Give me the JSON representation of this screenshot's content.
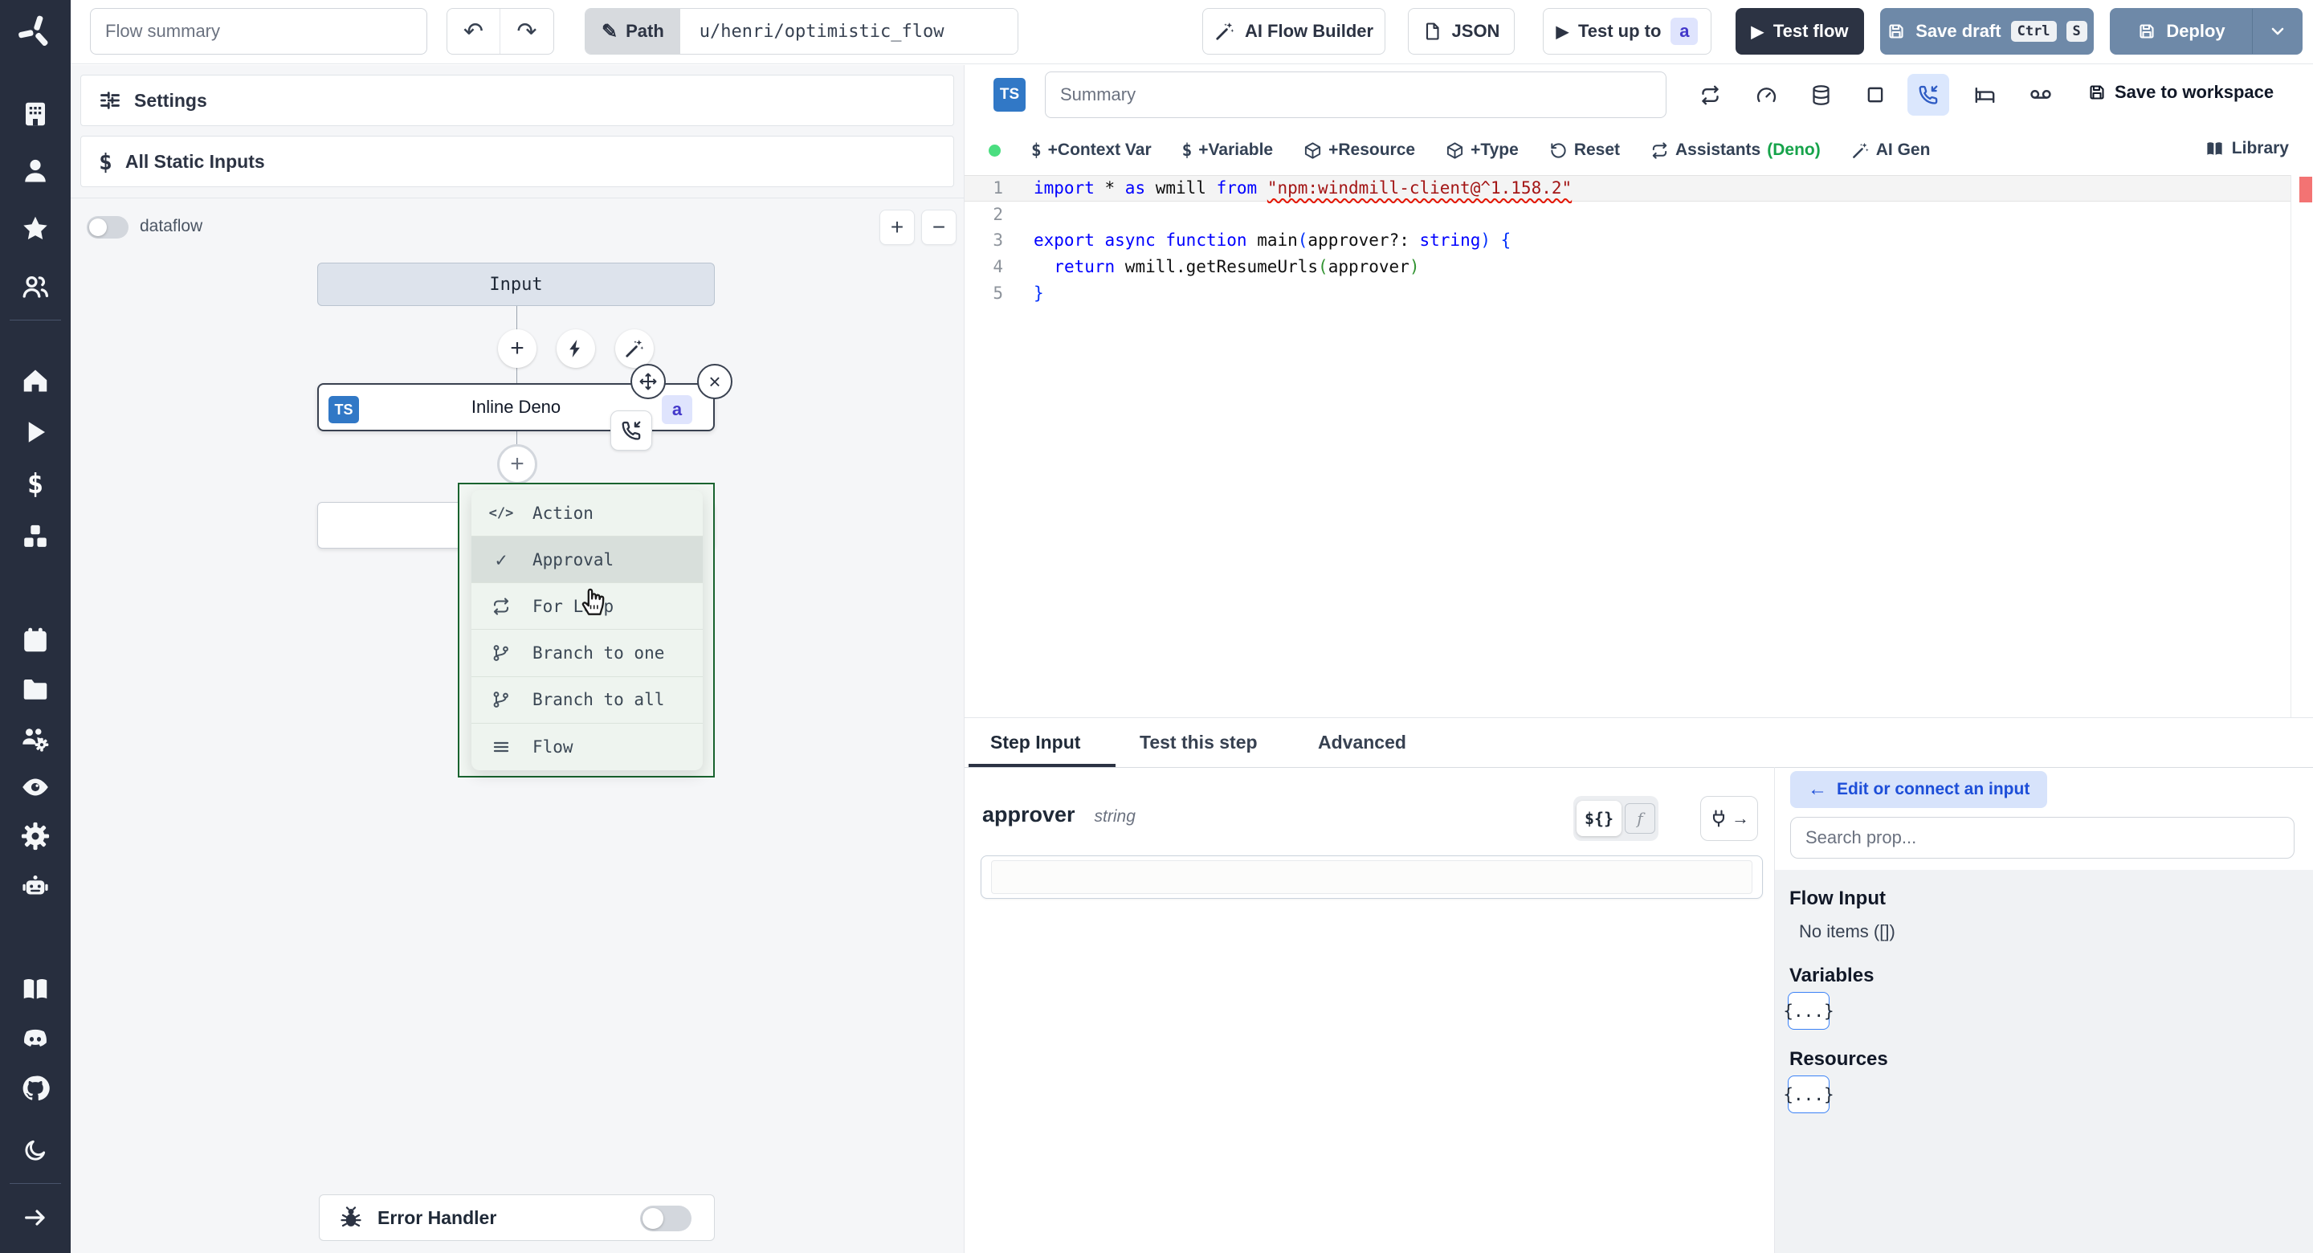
{
  "topbar": {
    "summary_placeholder": "Flow summary",
    "path_label": "Path",
    "path_value": "u/henri/optimistic_flow",
    "ai_flow_builder": "AI Flow Builder",
    "json_button": "JSON",
    "test_up_to": "Test up to",
    "step_badge": "a",
    "test_flow": "Test flow",
    "save_draft": "Save draft",
    "kbd_ctrl": "Ctrl",
    "kbd_s": "S",
    "deploy": "Deploy"
  },
  "sidebar": {
    "icons": [
      "windmill-logo",
      "workspace-building",
      "user",
      "favorites-star",
      "groups",
      "home",
      "runs-play",
      "variables-dollar",
      "resources-cubes",
      "schedules-calendar",
      "folders",
      "workers",
      "audit-eye",
      "settings-gear",
      "ai-robot",
      "docs-book",
      "discord",
      "github",
      "dark-mode-moon",
      "expand-arrow"
    ]
  },
  "flow_panel": {
    "settings": "Settings",
    "all_static_inputs": "All Static Inputs",
    "dataflow": "dataflow",
    "zoom_in": "+",
    "zoom_out": "−",
    "input_node": "Input",
    "step": {
      "lang_badge": "TS",
      "title": "Inline Deno",
      "id_badge": "a"
    },
    "insert_menu": {
      "items": [
        {
          "icon": "code",
          "label": "Action",
          "highlighted": false
        },
        {
          "icon": "check",
          "label": "Approval",
          "highlighted": true
        },
        {
          "icon": "repeat",
          "label": "For Loop",
          "highlighted": false
        },
        {
          "icon": "branch",
          "label": "Branch to one",
          "highlighted": false
        },
        {
          "icon": "branch",
          "label": "Branch to all",
          "highlighted": false
        },
        {
          "icon": "flow",
          "label": "Flow",
          "highlighted": false
        }
      ]
    },
    "error_handler": "Error Handler"
  },
  "editor": {
    "lang_badge": "TS",
    "summary_placeholder": "Summary",
    "save_to_workspace": "Save to workspace",
    "actions": {
      "context_var": "+Context Var",
      "variable": "+Variable",
      "resource": "+Resource",
      "type": "+Type",
      "reset": "Reset",
      "assistants": "Assistants",
      "assistants_lang": "(Deno)",
      "ai_gen": "AI Gen",
      "library": "Library"
    },
    "code": {
      "lines": [
        {
          "num": "1",
          "highlight": true,
          "tokens": [
            {
              "c": "kw",
              "t": "import"
            },
            {
              "c": "d",
              "t": " * "
            },
            {
              "c": "kw",
              "t": "as"
            },
            {
              "c": "d",
              "t": " wmill "
            },
            {
              "c": "kw",
              "t": "from"
            },
            {
              "c": "d",
              "t": " "
            },
            {
              "c": "str",
              "t": "\"npm:windmill-client@^1.158.2\""
            }
          ]
        },
        {
          "num": "2",
          "highlight": false,
          "tokens": []
        },
        {
          "num": "3",
          "highlight": false,
          "tokens": [
            {
              "c": "kw",
              "t": "export"
            },
            {
              "c": "d",
              "t": " "
            },
            {
              "c": "kw",
              "t": "async"
            },
            {
              "c": "d",
              "t": " "
            },
            {
              "c": "kw",
              "t": "function"
            },
            {
              "c": "d",
              "t": " main"
            },
            {
              "c": "b1",
              "t": "("
            },
            {
              "c": "d",
              "t": "approver?: "
            },
            {
              "c": "kw",
              "t": "string"
            },
            {
              "c": "b1",
              "t": ")"
            },
            {
              "c": "d",
              "t": " "
            },
            {
              "c": "b1",
              "t": "{"
            }
          ]
        },
        {
          "num": "4",
          "highlight": false,
          "tokens": [
            {
              "c": "d",
              "t": "  "
            },
            {
              "c": "kw",
              "t": "return"
            },
            {
              "c": "d",
              "t": " wmill.getResumeUrls"
            },
            {
              "c": "b2",
              "t": "("
            },
            {
              "c": "d",
              "t": "approver"
            },
            {
              "c": "b2",
              "t": ")"
            }
          ]
        },
        {
          "num": "5",
          "highlight": false,
          "tokens": [
            {
              "c": "b1",
              "t": "}"
            }
          ]
        }
      ]
    }
  },
  "step_panel": {
    "tabs": [
      {
        "label": "Step Input",
        "active": true
      },
      {
        "label": "Test this step",
        "active": false
      },
      {
        "label": "Advanced",
        "active": false
      }
    ],
    "field": {
      "name": "approver",
      "type": "string",
      "value": "",
      "mode_static": "${}",
      "mode_js": "f"
    },
    "connect": {
      "edit_button": "Edit or connect an input",
      "search_placeholder": "Search prop...",
      "flow_input_title": "Flow Input",
      "flow_input_empty": "No items ([])",
      "variables_title": "Variables",
      "variables_chip": "{...}",
      "resources_title": "Resources",
      "resources_chip": "{...}"
    }
  },
  "colors": {
    "accent_blue": "#3b82f6",
    "badge_indigo": "#4338ca",
    "deno_green": "#16a34a",
    "menu_border_green": "#19632f",
    "error_marker_red": "#ef4444",
    "ts_blue": "#3178c6",
    "dark_navy": "#2c3343",
    "slate_button": "#6e89a8"
  }
}
